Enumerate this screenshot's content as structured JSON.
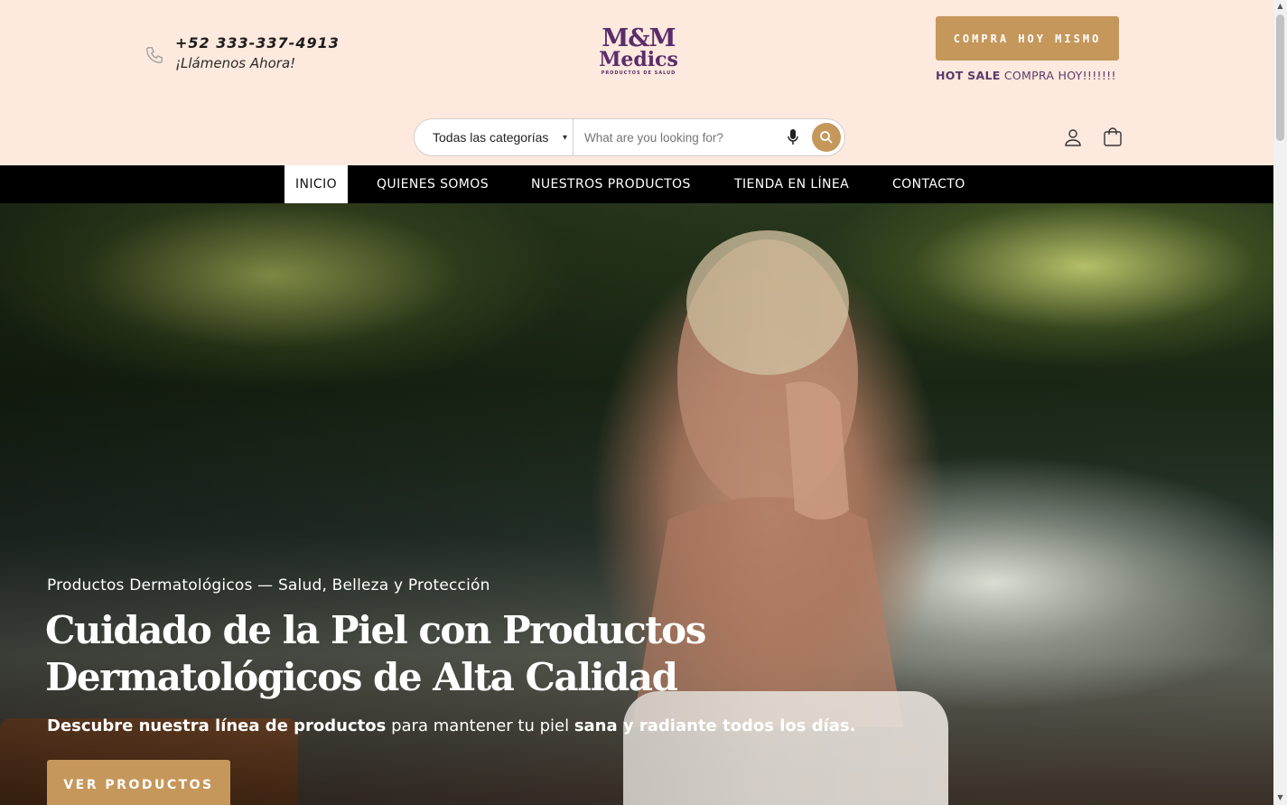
{
  "header": {
    "phone_number": "+52 333-337-4913",
    "phone_cta": "¡Llámenos Ahora!",
    "logo_line1": "M&M",
    "logo_line2": "Medics",
    "logo_tagline": "PRODUCTOS DE SALUD",
    "cta_button": "COMPRA HOY MISMO",
    "hot_sale_bold": "HOT SALE",
    "hot_sale_text": " COMPRA HOY!!!!!!!",
    "accent_color": "#c5975a",
    "brand_color": "#5a2d6b"
  },
  "search": {
    "category_selected": "Todas las categorías",
    "placeholder": "What are you looking for?"
  },
  "nav": {
    "items": [
      "INICIO",
      "QUIENES SOMOS",
      "NUESTROS PRODUCTOS",
      "TIENDA EN LÍNEA",
      "CONTACTO"
    ],
    "active": "INICIO"
  },
  "hero": {
    "eyebrow": "Productos Dermatológicos — Salud, Belleza y Protección",
    "title_line1": "Cuidado de la Piel con Productos",
    "title_line2": "Dermatológicos de Alta Calidad",
    "sub_part1": "Descubre nuestra línea de productos",
    "sub_part2": " para mantener tu piel ",
    "sub_part3": "sana y radiante todos los días.",
    "button": "VER PRODUCTOS"
  },
  "icons": [
    "phone-icon",
    "mic-icon",
    "search-icon",
    "user-icon",
    "cart-icon"
  ]
}
